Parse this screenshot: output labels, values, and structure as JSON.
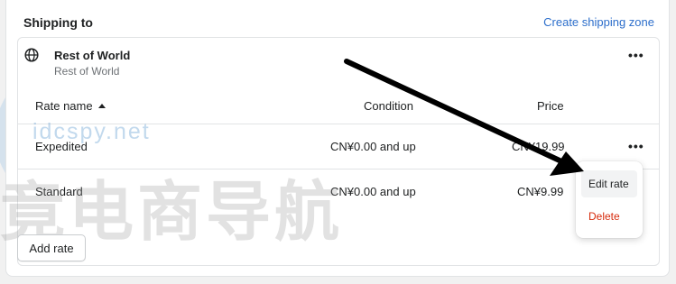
{
  "header": {
    "title": "Shipping to",
    "create_link": "Create shipping zone"
  },
  "zone": {
    "icon": "globe-icon",
    "name": "Rest of World",
    "countries": "Rest of World",
    "more_label": "•••"
  },
  "table": {
    "columns": {
      "rate_name": "Rate name",
      "condition": "Condition",
      "price": "Price"
    },
    "rows": [
      {
        "name": "Expedited",
        "condition": "CN¥0.00 and up",
        "price": "CN¥19.99",
        "more_label": "•••"
      },
      {
        "name": "Standard",
        "condition": "CN¥0.00 and up",
        "price": "CN¥9.99"
      }
    ]
  },
  "actions": {
    "add_rate": "Add rate"
  },
  "popover_menu": {
    "items": [
      {
        "label": "Edit rate",
        "color": "#202223"
      },
      {
        "label": "Delete",
        "color": "#d72c0d"
      }
    ]
  },
  "watermark": {
    "latin": "idcspy.net",
    "chinese": "竟电商导航"
  },
  "colors": {
    "link": "#2c6ecb",
    "destructive": "#d72c0d",
    "border": "#e1e3e5"
  }
}
